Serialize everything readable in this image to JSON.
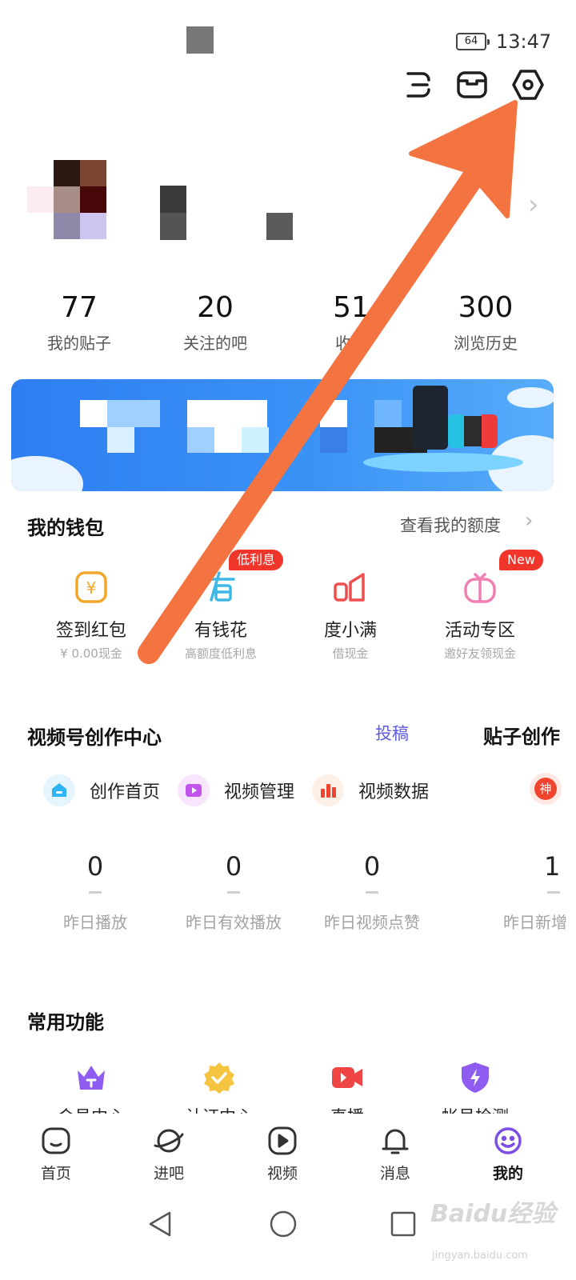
{
  "status_bar": {
    "time": "13:47",
    "battery": "64"
  },
  "top_icons": [
    "scan-icon",
    "box-icon",
    "settings-gear-icon"
  ],
  "stats": [
    {
      "value": "77",
      "label": "我的贴子"
    },
    {
      "value": "20",
      "label": "关注的吧"
    },
    {
      "value": "51",
      "label": "收藏"
    },
    {
      "value": "300",
      "label": "浏览历史"
    }
  ],
  "wallet": {
    "title": "我的钱包",
    "link": "查看我的额度",
    "items": [
      {
        "title": "签到红包",
        "sub": "¥ 0.00现金",
        "icon": "coin-icon",
        "color": "#f4a62a"
      },
      {
        "title": "有钱花",
        "sub": "高额度低利息",
        "icon": "you-char-icon",
        "color": "#3fb7e6",
        "badge": "低利息"
      },
      {
        "title": "度小满",
        "sub": "借现金",
        "icon": "duxiaoman-icon",
        "color": "#f04f4f"
      },
      {
        "title": "活动专区",
        "sub": "邀好友领现金",
        "icon": "gift-icon",
        "color": "#f07fb4",
        "badge": "New"
      }
    ]
  },
  "creation": {
    "title": "视频号创作中心",
    "submit": "投稿",
    "post_creator": "贴子创作",
    "items": [
      {
        "label": "创作首页",
        "icon": "home-icon",
        "color": "#2fb5f5"
      },
      {
        "label": "视频管理",
        "icon": "video-manage-icon",
        "color": "#c153ea"
      },
      {
        "label": "视频数据",
        "icon": "data-bars-icon",
        "color": "#f0442f"
      }
    ],
    "extra_icon_text": "神",
    "metrics": [
      {
        "value": "0",
        "label": "昨日播放"
      },
      {
        "value": "0",
        "label": "昨日有效播放"
      },
      {
        "value": "0",
        "label": "昨日视频点赞"
      },
      {
        "value": "1",
        "label": "昨日新增"
      }
    ]
  },
  "common": {
    "title": "常用功能",
    "items": [
      {
        "label": "会员中心",
        "icon": "crown-icon",
        "color": "#8e5cf0"
      },
      {
        "label": "认证中心",
        "icon": "badge-check-icon",
        "color": "#f5c542"
      },
      {
        "label": "直播",
        "icon": "live-camera-icon",
        "color": "#f04545"
      },
      {
        "label": "帐号检测",
        "icon": "shield-bolt-icon",
        "color": "#8e5cf0"
      }
    ]
  },
  "tabs": [
    {
      "label": "首页",
      "icon": "home-tab-icon"
    },
    {
      "label": "进吧",
      "icon": "planet-icon"
    },
    {
      "label": "视频",
      "icon": "play-icon"
    },
    {
      "label": "消息",
      "icon": "bell-icon"
    },
    {
      "label": "我的",
      "icon": "smile-icon",
      "active": true
    }
  ],
  "watermark": {
    "text": "Baidu经验",
    "sub": "jingyan.baidu.com"
  },
  "colors": {
    "arrow": "#f37341",
    "accent": "#5c5adf",
    "badge": "#f0352b"
  }
}
